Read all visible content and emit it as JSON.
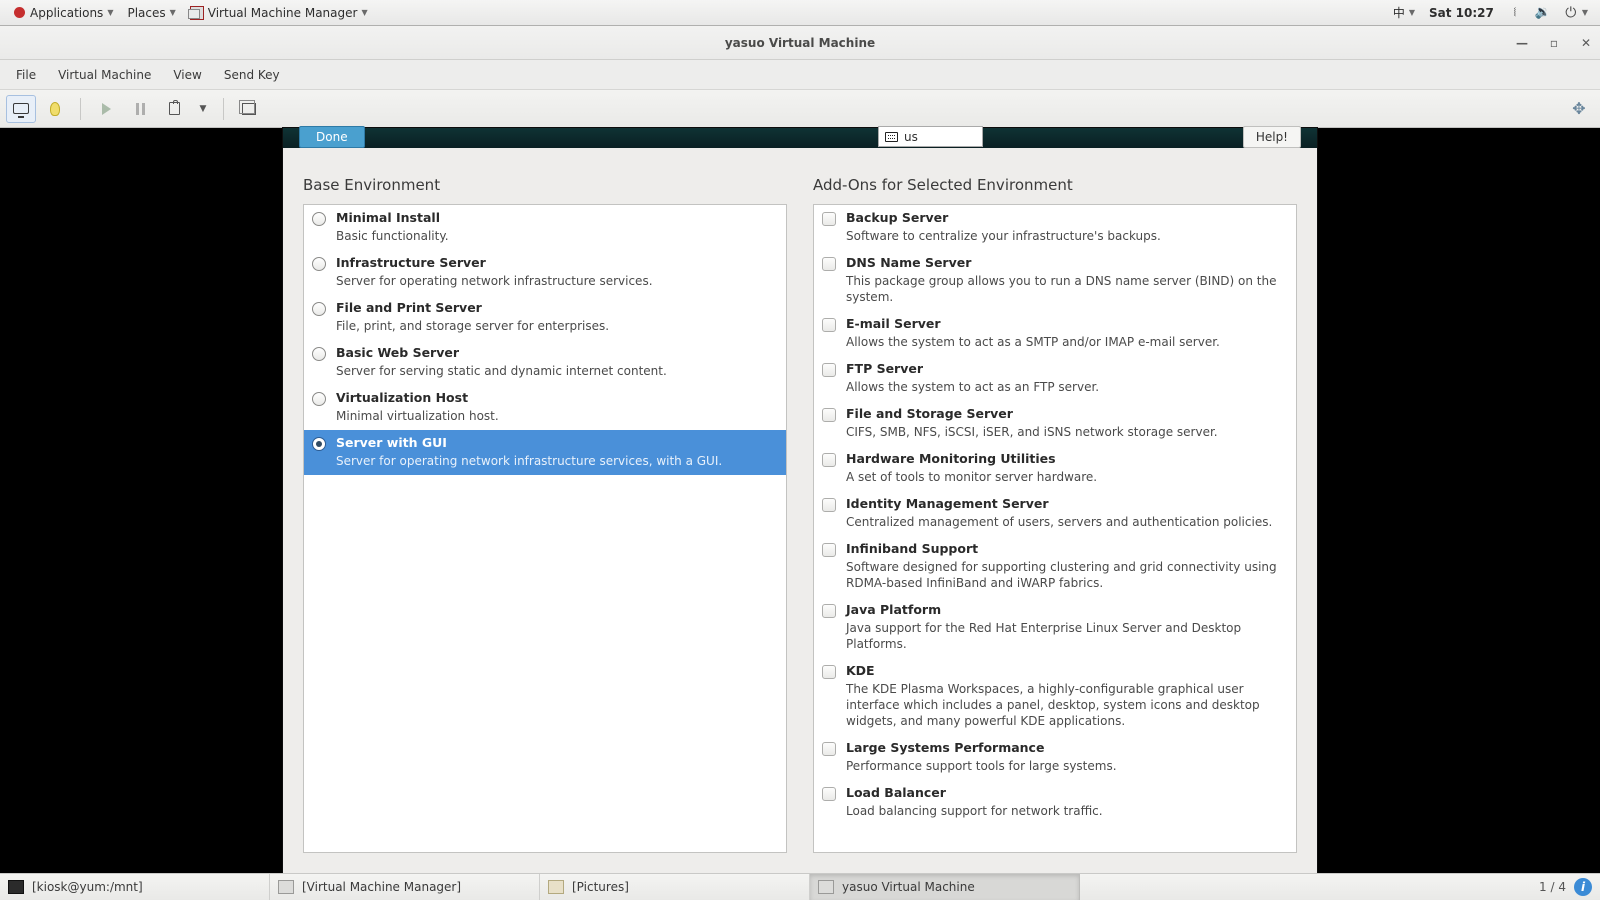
{
  "topbar": {
    "applications": "Applications",
    "places": "Places",
    "vmm": "Virtual Machine Manager",
    "ime": "中",
    "clock": "Sat 10:27"
  },
  "window": {
    "title": "yasuo Virtual Machine"
  },
  "menus": {
    "file": "File",
    "vm": "Virtual Machine",
    "view": "View",
    "sendkey": "Send Key"
  },
  "ana": {
    "done": "Done",
    "kb": "us",
    "help": "Help!",
    "base_heading": "Base Environment",
    "addons_heading": "Add-Ons for Selected Environment",
    "base": [
      {
        "t": "Minimal Install",
        "d": "Basic functionality."
      },
      {
        "t": "Infrastructure Server",
        "d": "Server for operating network infrastructure services."
      },
      {
        "t": "File and Print Server",
        "d": "File, print, and storage server for enterprises."
      },
      {
        "t": "Basic Web Server",
        "d": "Server for serving static and dynamic internet content."
      },
      {
        "t": "Virtualization Host",
        "d": "Minimal virtualization host."
      },
      {
        "t": "Server with GUI",
        "d": "Server for operating network infrastructure services, with a GUI."
      }
    ],
    "base_selected_index": 5,
    "addons": [
      {
        "t": "Backup Server",
        "d": "Software to centralize your infrastructure's backups."
      },
      {
        "t": "DNS Name Server",
        "d": "This package group allows you to run a DNS name server (BIND) on the system."
      },
      {
        "t": "E-mail Server",
        "d": "Allows the system to act as a SMTP and/or IMAP e-mail server."
      },
      {
        "t": "FTP Server",
        "d": "Allows the system to act as an FTP server."
      },
      {
        "t": "File and Storage Server",
        "d": "CIFS, SMB, NFS, iSCSI, iSER, and iSNS network storage server."
      },
      {
        "t": "Hardware Monitoring Utilities",
        "d": "A set of tools to monitor server hardware."
      },
      {
        "t": "Identity Management Server",
        "d": "Centralized management of users, servers and authentication policies."
      },
      {
        "t": "Infiniband Support",
        "d": "Software designed for supporting clustering and grid connectivity using RDMA-based InfiniBand and iWARP fabrics."
      },
      {
        "t": "Java Platform",
        "d": "Java support for the Red Hat Enterprise Linux Server and Desktop Platforms."
      },
      {
        "t": "KDE",
        "d": "The KDE Plasma Workspaces, a highly-configurable graphical user interface which includes a panel, desktop, system icons and desktop widgets, and many powerful KDE applications."
      },
      {
        "t": "Large Systems Performance",
        "d": "Performance support tools for large systems."
      },
      {
        "t": "Load Balancer",
        "d": "Load balancing support for network traffic."
      }
    ]
  },
  "panel": {
    "tasks": [
      {
        "label": "[kiosk@yum:/mnt]",
        "kind": "term"
      },
      {
        "label": "[Virtual Machine Manager]",
        "kind": "vmm"
      },
      {
        "label": "[Pictures]",
        "kind": "folder"
      },
      {
        "label": "yasuo Virtual Machine",
        "kind": "vmm",
        "active": true
      }
    ],
    "workspace": "1 / 4"
  }
}
